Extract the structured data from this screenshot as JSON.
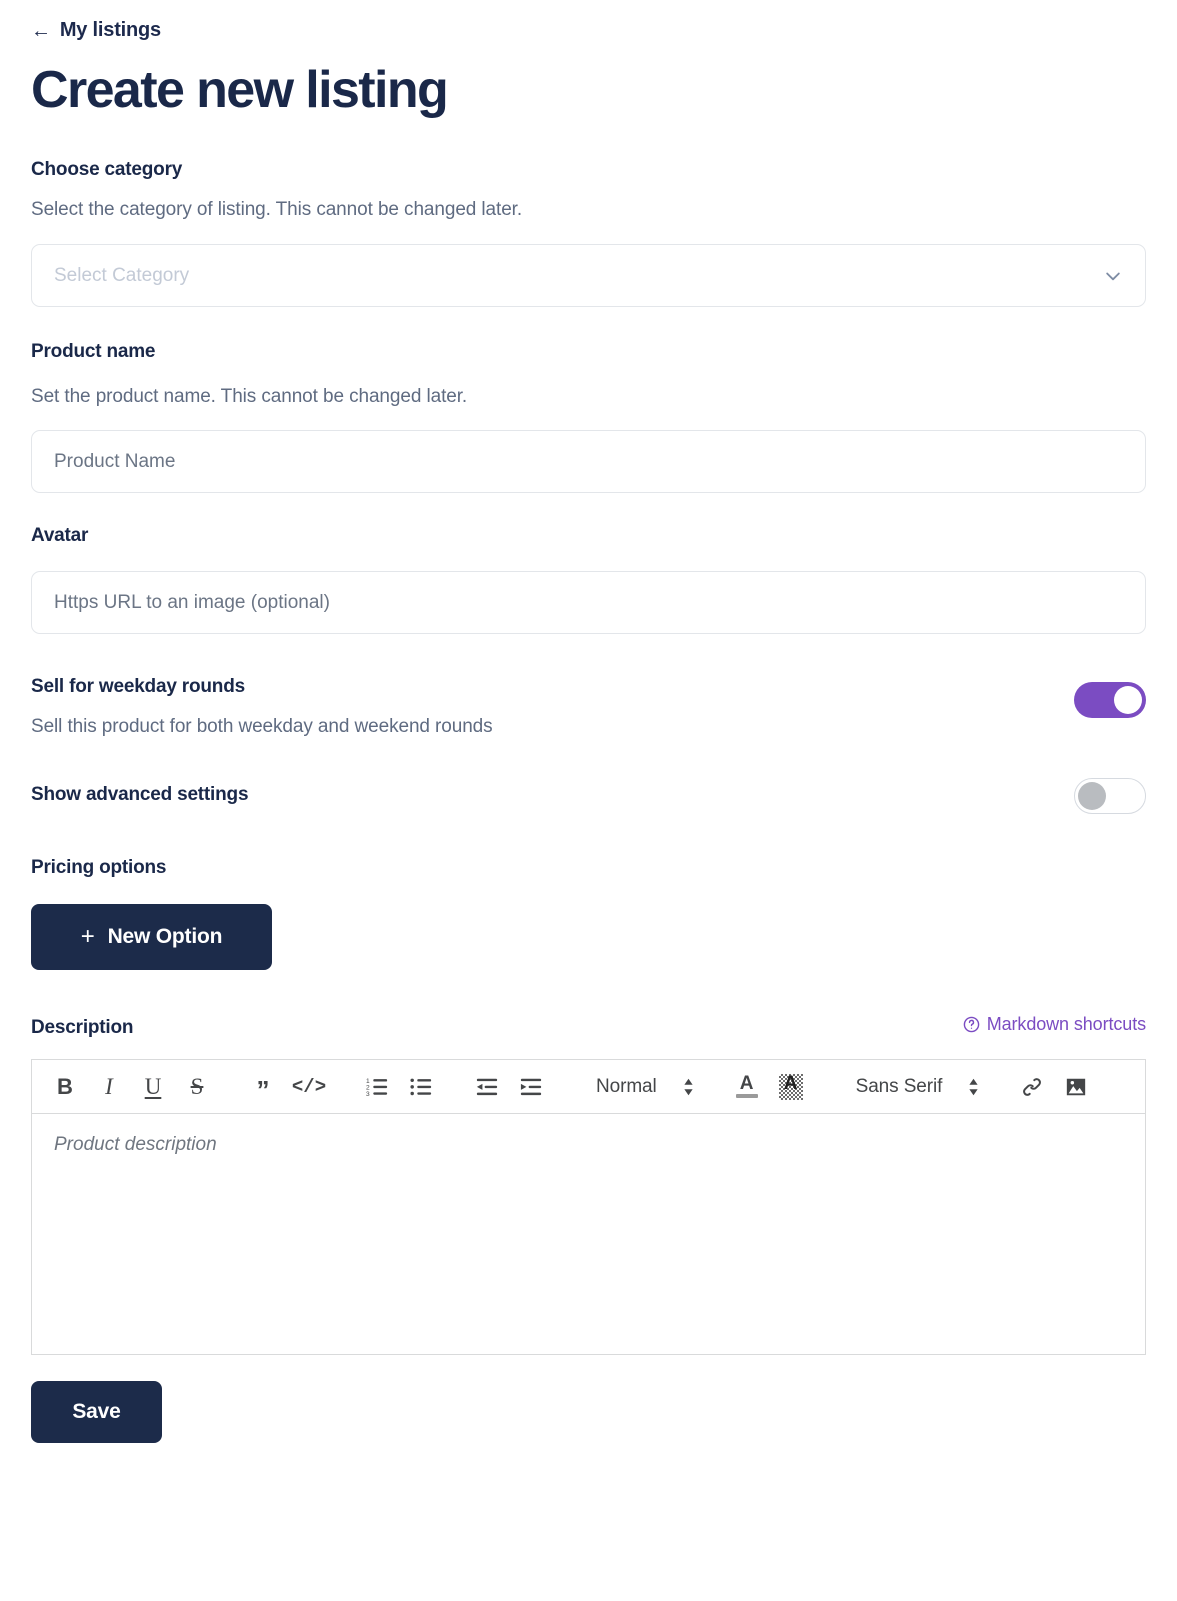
{
  "header": {
    "back_link": "My listings",
    "back_icon": "arrow-left-icon",
    "title": "Create new listing"
  },
  "category": {
    "label": "Choose category",
    "help": "Select the category of listing. This cannot be changed later.",
    "placeholder": "Select Category",
    "value": "",
    "chevron_icon": "chevron-down-icon"
  },
  "product_name": {
    "label": "Product name",
    "help": "Set the product name. This cannot be changed later.",
    "placeholder": "Product Name",
    "value": ""
  },
  "avatar": {
    "label": "Avatar",
    "placeholder": "Https URL to an image (optional)",
    "value": ""
  },
  "weekday_toggle": {
    "label": "Sell for weekday rounds",
    "help": "Sell this product for both weekday and weekend rounds",
    "state": "on"
  },
  "advanced_toggle": {
    "label": "Show advanced settings",
    "state": "off"
  },
  "pricing": {
    "label": "Pricing options",
    "new_option_label": "New Option",
    "plus_glyph": "+"
  },
  "description": {
    "label": "Description",
    "markdown_link": "Markdown shortcuts",
    "markdown_icon": "question-circle-icon",
    "placeholder": "Product description",
    "value": "",
    "toolbar": {
      "bold": "B",
      "italic": "I",
      "underline": "U",
      "strike": "S",
      "blockquote": "”",
      "code": "</>",
      "ordered_list": "ordered-list-icon",
      "bullet_list": "bullet-list-icon",
      "outdent": "outdent-icon",
      "indent": "indent-icon",
      "block_format": "Normal",
      "text_color": "A",
      "background_color": "A",
      "font_family": "Sans Serif",
      "link": "link-icon",
      "image": "image-icon"
    }
  },
  "footer": {
    "save_label": "Save"
  },
  "colors": {
    "accent_purple": "#7b4cc2",
    "dark_navy": "#1c2b4a",
    "text_muted": "#5f6b81",
    "border": "#e3e6ea"
  }
}
